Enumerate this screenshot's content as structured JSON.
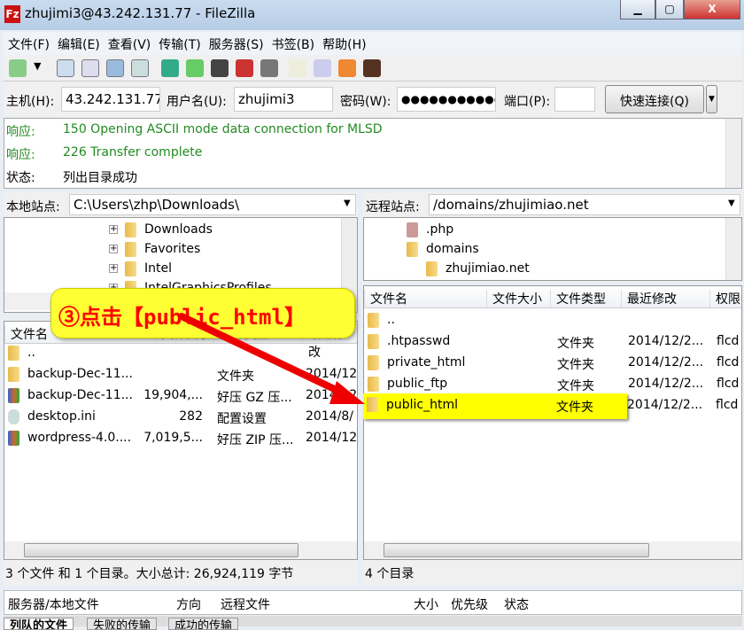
{
  "window": {
    "title": "zhujimi3@43.242.131.77 - FileZilla",
    "min": "▁",
    "max": "▢",
    "close": "X"
  },
  "menu": [
    "文件(F)",
    "编辑(E)",
    "查看(V)",
    "传输(T)",
    "服务器(S)",
    "书签(B)",
    "帮助(H)"
  ],
  "quickconnect": {
    "host_label": "主机(H):",
    "host": "43.242.131.77",
    "user_label": "用户名(U):",
    "user": "zhujimi3",
    "pass_label": "密码(W):",
    "pass": "●●●●●●●●●●●",
    "port_label": "端口(P):",
    "port": "",
    "button": "快速连接(Q)"
  },
  "log": [
    {
      "label": "响应:",
      "text": "150 Opening ASCII mode data connection for MLSD",
      "color": "#228b22"
    },
    {
      "label": "响应:",
      "text": "226 Transfer complete",
      "color": "#228b22"
    },
    {
      "label": "状态:",
      "text": "列出目录成功",
      "color": "#000000"
    }
  ],
  "local": {
    "site_label": "本地站点:",
    "path": "C:\\Users\\zhp\\Downloads\\",
    "tree": [
      "Downloads",
      "Favorites",
      "Intel",
      "IntelGraphicsProfiles"
    ],
    "columns": [
      "文件名",
      "文件大小",
      "文件类型",
      "最近修改"
    ],
    "files": [
      {
        "name": "..",
        "size": "",
        "type": "",
        "date": "",
        "icon": "folder"
      },
      {
        "name": "backup-Dec-11...",
        "size": "",
        "type": "文件夹",
        "date": "2014/12",
        "icon": "folder"
      },
      {
        "name": "backup-Dec-11...",
        "size": "19,904,...",
        "type": "好压 GZ 压...",
        "date": "2014/12",
        "icon": "archive"
      },
      {
        "name": "desktop.ini",
        "size": "282",
        "type": "配置设置",
        "date": "2014/8/",
        "icon": "settings-file"
      },
      {
        "name": "wordpress-4.0....",
        "size": "7,019,5...",
        "type": "好压 ZIP 压...",
        "date": "2014/12",
        "icon": "archive"
      }
    ],
    "status": "3 个文件 和 1 个目录。大小总计: 26,924,119 字节"
  },
  "remote": {
    "site_label": "远程站点:",
    "path": "/domains/zhujimiao.net",
    "tree": [
      ".php",
      "domains",
      "zhujimiao.net"
    ],
    "columns": [
      "文件名",
      "文件大小",
      "文件类型",
      "最近修改",
      "权限"
    ],
    "files": [
      {
        "name": "..",
        "type": "",
        "date": "",
        "perm": ""
      },
      {
        "name": ".htpasswd",
        "type": "文件夹",
        "date": "2014/12/2...",
        "perm": "flcd"
      },
      {
        "name": "private_html",
        "type": "文件夹",
        "date": "2014/12/2...",
        "perm": "flcd"
      },
      {
        "name": "public_ftp",
        "type": "文件夹",
        "date": "2014/12/2...",
        "perm": "flcd"
      },
      {
        "name": "public_html",
        "type": "文件夹",
        "date": "2014/12/2...",
        "perm": "flcd"
      }
    ],
    "status": "4 个目录"
  },
  "queue": {
    "columns": [
      "服务器/本地文件",
      "方向",
      "远程文件",
      "大小",
      "优先级",
      "状态"
    ],
    "tabs": [
      "列队的文件",
      "失败的传输",
      "成功的传输"
    ]
  },
  "annotation": {
    "text": "③点击【public_html】",
    "highlight": "#ffff00",
    "text_color": "#ff0000"
  }
}
